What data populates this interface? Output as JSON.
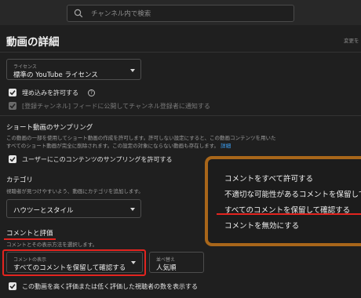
{
  "search": {
    "placeholder": "チャンネル内で検索"
  },
  "page": {
    "title": "動画の詳細",
    "top_right_link": "変更を"
  },
  "license": {
    "label": "ライセンス",
    "value": "標準の YouTube ライセンス"
  },
  "embedding": {
    "allow_label": "埋め込みを許可する",
    "notify_label": "[登録チャンネル] フィードに公開してチャンネル登録者に通知する"
  },
  "shorts_sampling": {
    "title": "ショート動画のサンプリング",
    "desc_line1": "この動画の一部を使用してショート動画の作成を許可します。許可しない設定にすると、この動画コンテンツを用いた",
    "desc_line2": "すべてのショート動画が完全に削除されます。この設定の対象にならない動画も存在します。",
    "link": "詳細",
    "checkbox_label": "ユーザーにこのコンテンツのサンプリングを許可する"
  },
  "category": {
    "title": "カテゴリ",
    "desc": "視聴者が見つけやすいよう、動画にカテゴリを追加します。",
    "value": "ハウツーとスタイル"
  },
  "comments": {
    "title": "コメントと評価",
    "desc": "コメントとその表示方法を選択します。",
    "visibility_label": "コメントの表示",
    "visibility_value": "すべてのコメントを保留して確認する",
    "sort_label": "並べ替え",
    "sort_value": "人気順",
    "rating_checkbox_label": "この動画を高く評価または低く評価した視聴者の数を表示する"
  },
  "dropdown_menu": {
    "items": [
      "コメントをすべて許可する",
      "不適切な可能性があるコメントを保留して確",
      "すべてのコメントを保留して確認する",
      "コメントを無効にする"
    ]
  },
  "colors": {
    "background": "#1f1f1f",
    "highlight_red": "#e3241f",
    "highlight_orange": "#a8661a",
    "link_blue": "#3ea6ff"
  }
}
